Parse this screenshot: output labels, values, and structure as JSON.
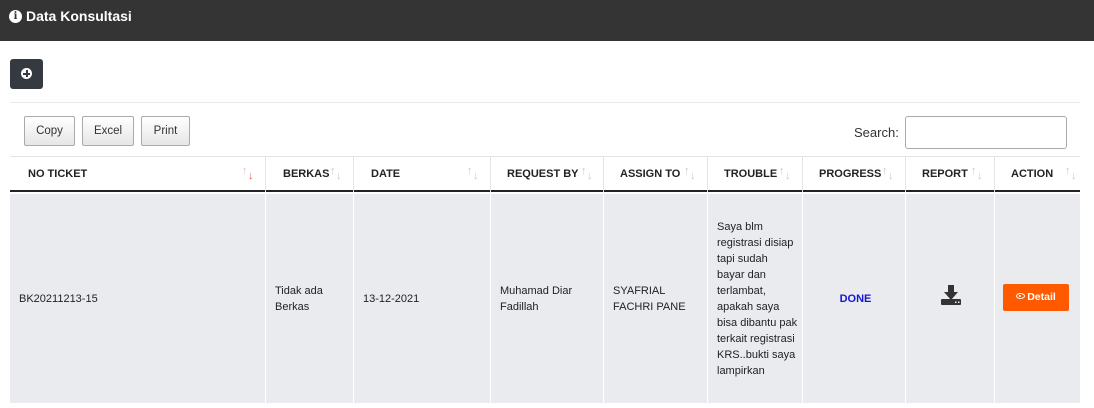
{
  "header": {
    "title": "Data Konsultasi",
    "icon": "info-circle-icon"
  },
  "toolbar": {
    "add_icon": "plus-circle-icon"
  },
  "export_buttons": {
    "copy": "Copy",
    "excel": "Excel",
    "print": "Print"
  },
  "search": {
    "label": "Search:",
    "value": ""
  },
  "table": {
    "columns": [
      "NO TICKET",
      "BERKAS",
      "DATE",
      "REQUEST BY",
      "ASSIGN TO",
      "TROUBLE",
      "PROGRESS",
      "REPORT",
      "ACTION"
    ],
    "sorted_column": "NO TICKET",
    "rows": [
      {
        "no_ticket": "BK20211213-15",
        "berkas": "Tidak ada Berkas",
        "date": "13-12-2021",
        "request_by": "Muhamad Diar Fadillah",
        "assign_to": "SYAFRIAL FACHRI PANE",
        "trouble": "Saya blm registrasi disiap tapi sudah bayar dan terlambat, apakah saya bisa dibantu pak terkait registrasi KRS..bukti saya lampirkan",
        "progress": "DONE",
        "report_icon": "download-icon",
        "action": "Detail"
      }
    ]
  },
  "colors": {
    "header_bg": "#343434",
    "row_bg": "#e9ebef",
    "done": "#1515d6",
    "detail_btn": "#ff5a00"
  }
}
